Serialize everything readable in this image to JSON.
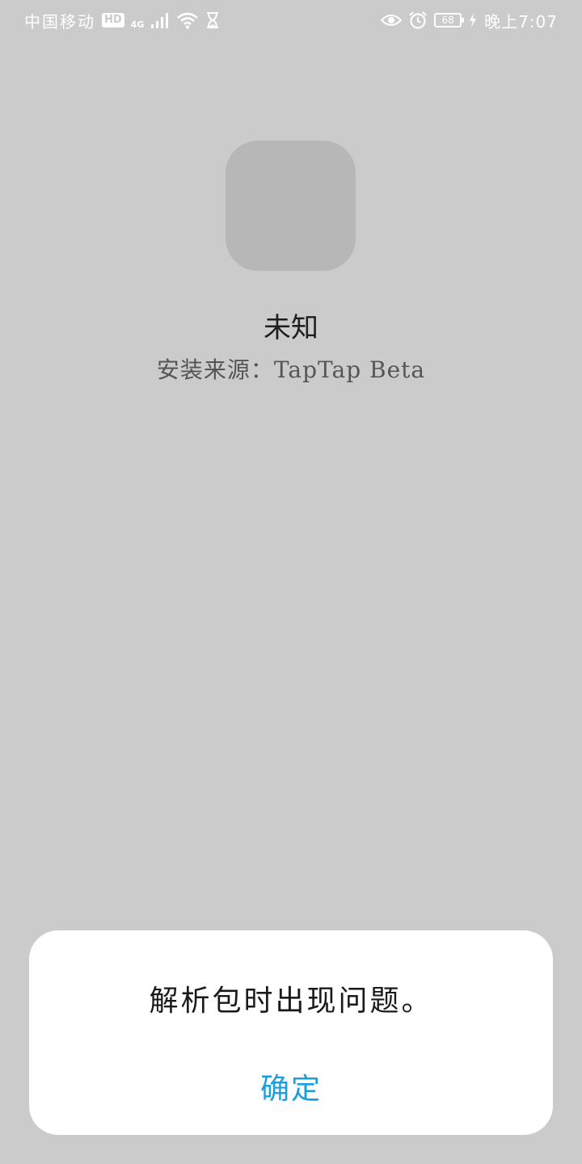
{
  "status_bar": {
    "carrier": "中国移动",
    "hd_badge": "HD",
    "network_type": "4G",
    "battery_level": "68",
    "time": "晚上7:07"
  },
  "app_info": {
    "name": "未知",
    "install_source": "安装来源：TapTap Beta"
  },
  "dialog": {
    "message": "解析包时出现问题。",
    "confirm_label": "确定"
  },
  "colors": {
    "background": "#cbcbcb",
    "icon_placeholder": "#b7b7b7",
    "dialog_background": "#ffffff",
    "accent": "#1a9ee0"
  },
  "icons": [
    "signal-icon",
    "wifi-icon",
    "hourglass-icon",
    "eye-icon",
    "alarm-icon",
    "battery-icon",
    "charging-icon"
  ]
}
